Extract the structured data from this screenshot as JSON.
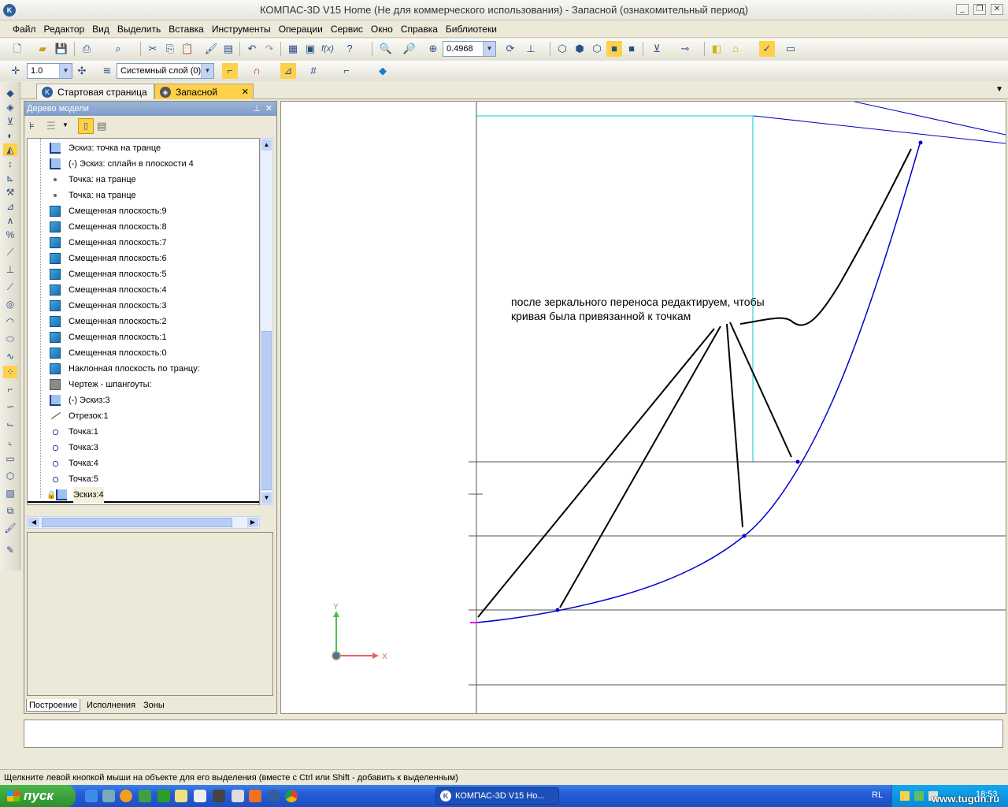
{
  "window": {
    "title": "КОМПАС-3D V15 Home (Не для коммерческого использования) - Запасной (ознакомительный период)",
    "minimize_icon": "minimize-icon",
    "restore_icon": "restore-icon",
    "close_icon": "close-icon"
  },
  "menu": [
    "Файл",
    "Редактор",
    "Вид",
    "Выделить",
    "Вставка",
    "Инструменты",
    "Операции",
    "Сервис",
    "Окно",
    "Справка",
    "Библиотеки"
  ],
  "toolbar": {
    "zoom_value": "0.4968"
  },
  "toolbar2": {
    "step_value": "1.0",
    "layer_value": "Системный слой (0)"
  },
  "tabs": {
    "start_page": "Стартовая страница",
    "active_doc": "Запасной"
  },
  "tree": {
    "header": "Дерево модели",
    "rows": [
      {
        "label": "Эскиз: точка на транце",
        "icon": "sketch-icon"
      },
      {
        "label": "(-) Эскиз: сплайн  в плоскости 4",
        "icon": "sketch-icon"
      },
      {
        "label": "Точка: на транце",
        "icon": "point-icon"
      },
      {
        "label": "Точка: на транце",
        "icon": "point-icon"
      },
      {
        "label": "Смещенная плоскость:9",
        "icon": "plane-icon"
      },
      {
        "label": "Смещенная плоскость:8",
        "icon": "plane-icon"
      },
      {
        "label": "Смещенная плоскость:7",
        "icon": "plane-icon"
      },
      {
        "label": "Смещенная плоскость:6",
        "icon": "plane-icon"
      },
      {
        "label": "Смещенная плоскость:5",
        "icon": "plane-icon"
      },
      {
        "label": "Смещенная плоскость:4",
        "icon": "plane-icon"
      },
      {
        "label": "Смещенная плоскость:3",
        "icon": "plane-icon"
      },
      {
        "label": "Смещенная плоскость:2",
        "icon": "plane-icon"
      },
      {
        "label": "Смещенная плоскость:1",
        "icon": "plane-icon"
      },
      {
        "label": "Смещенная плоскость:0",
        "icon": "plane-icon"
      },
      {
        "label": "Наклонная плоскость по транцу:",
        "icon": "plane-icon"
      },
      {
        "label": "Чертеж -  шпангоуты:",
        "icon": "drawing-icon"
      },
      {
        "label": "(-) Эскиз:3",
        "icon": "sketch-icon"
      },
      {
        "label": "Отрезок:1",
        "icon": "segment-icon"
      },
      {
        "label": "Точка:1",
        "icon": "circle-point-icon"
      },
      {
        "label": "Точка:3",
        "icon": "circle-point-icon"
      },
      {
        "label": "Точка:4",
        "icon": "circle-point-icon"
      },
      {
        "label": "Точка:5",
        "icon": "circle-point-icon"
      },
      {
        "label": "Эскиз:4",
        "icon": "sketch-icon"
      }
    ],
    "bottom_tabs": [
      "Построение",
      "Исполнения",
      "Зоны"
    ]
  },
  "canvas": {
    "annotation_line1": "после зеркального переноса редактируем, чтобы",
    "annotation_line2": "кривая была привязанной к точкам",
    "axis_y": "Y",
    "axis_x": "X"
  },
  "status": "Щелкните левой кнопкой мыши на объекте для его выделения (вместе с Ctrl или Shift - добавить к выделенным)",
  "taskbar": {
    "start": "пуск",
    "task": "КОМПАС-3D V15 Ho...",
    "lang": "RL",
    "clock": "18:53",
    "watermark": "www.tugun.ru"
  }
}
